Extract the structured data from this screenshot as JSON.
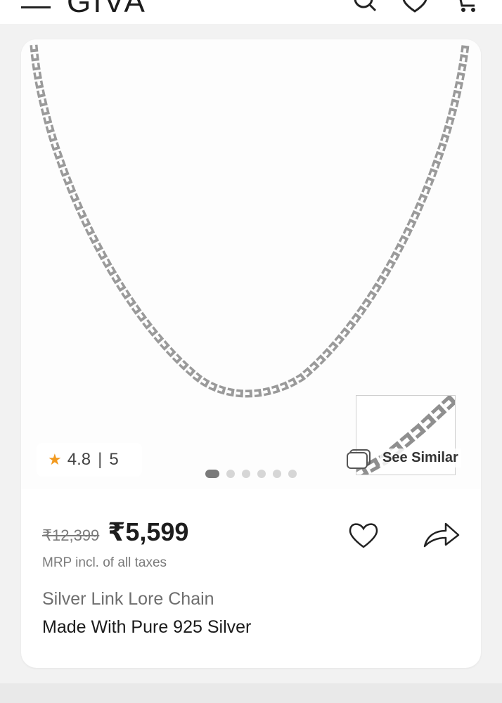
{
  "header": {
    "brand": "GIVA",
    "icons": [
      "menu-icon",
      "search-icon",
      "heart-icon",
      "cart-icon"
    ]
  },
  "gallery": {
    "rating": {
      "value": "4.8",
      "separator": "|",
      "count": "5"
    },
    "see_similar_label": "See Similar",
    "slide_count": 6,
    "active_slide": 1
  },
  "product": {
    "mrp_old": "₹12,399",
    "price": "₹5,599",
    "tax_note": "MRP incl. of all taxes",
    "name": "Silver Link Lore Chain",
    "subtitle": "Made With Pure 925 Silver"
  },
  "colors": {
    "star": "#f29a1f",
    "active_dot": "#7a7a7a",
    "inactive_dot": "#d6d6d6"
  }
}
